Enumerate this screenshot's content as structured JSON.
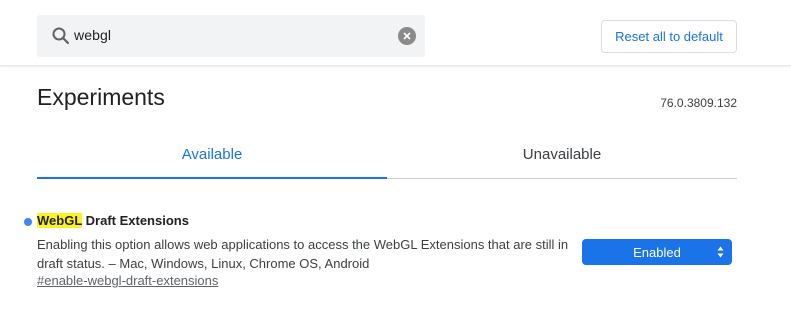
{
  "search": {
    "value": "webgl",
    "icon": "search-icon"
  },
  "reset_button": {
    "label": "Reset all to default"
  },
  "page": {
    "title": "Experiments",
    "version": "76.0.3809.132"
  },
  "tabs": [
    {
      "label": "Available",
      "active": true
    },
    {
      "label": "Unavailable",
      "active": false
    }
  ],
  "experiment": {
    "title_highlight": "WebGL",
    "title_rest": " Draft Extensions",
    "description": "Enabling this option allows web applications to access the WebGL Extensions that are still in draft status. – Mac, Windows, Linux, Chrome OS, Android",
    "link": "#enable-webgl-draft-extensions",
    "select_value": "Enabled"
  },
  "colors": {
    "accent": "#1a73e8",
    "highlight": "#fbf221",
    "status_dot": "#4285f4"
  }
}
